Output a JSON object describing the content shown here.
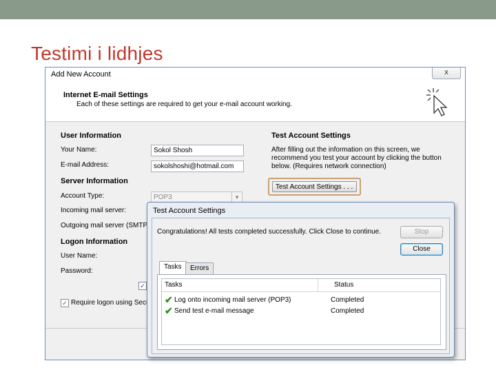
{
  "slide": {
    "title": "Testimi i lidhjes"
  },
  "dialog": {
    "title": "Add New Account",
    "close_glyph": "x",
    "header_title": "Internet E-mail Settings",
    "header_desc": "Each of these settings are required to get your e-mail account working."
  },
  "user_info": {
    "section": "User Information",
    "name_label": "Your Name:",
    "name_value": "Sokol Shosh",
    "email_label": "E-mail Address:",
    "email_value": "sokolshoshi@hotmail.com"
  },
  "server_info": {
    "section": "Server Information",
    "account_type_label": "Account Type:",
    "account_type_value": "POP3",
    "incoming_label": "Incoming mail server:",
    "outgoing_label": "Outgoing mail server (SMTP):"
  },
  "logon_info": {
    "section": "Logon Information",
    "username_label": "User Name:",
    "password_label": "Password:",
    "require_logon_label": "Require logon using Secure"
  },
  "test_settings": {
    "section": "Test Account Settings",
    "desc": "After filling out the information on this screen, we recommend you test your account by clicking the button below. (Requires network connection)",
    "button_label": "Test Account Settings . . ."
  },
  "popup": {
    "title": "Test Account Settings",
    "message": "Congratulations! All tests completed successfully. Click Close to continue.",
    "stop_label": "Stop",
    "close_label": "Close",
    "tabs": [
      "Tasks",
      "Errors"
    ],
    "columns": {
      "tasks": "Tasks",
      "status": "Status"
    },
    "rows": [
      {
        "task": "Log onto incoming mail server (POP3)",
        "status": "Completed"
      },
      {
        "task": "Send test e-mail message",
        "status": "Completed"
      }
    ]
  },
  "icons": {
    "cursor": "click-cursor-icon",
    "check": "checkmark-icon"
  }
}
